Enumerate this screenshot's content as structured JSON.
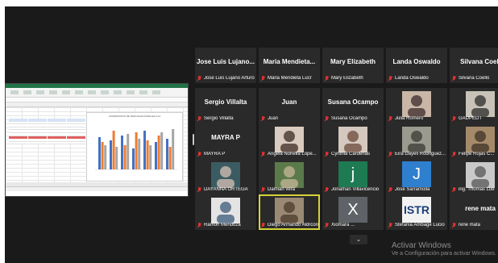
{
  "participants": [
    {
      "big": "Jose Luis Lujano...",
      "cap": "Jose Luis Lujano Arturo",
      "kind": "name"
    },
    {
      "big": "Maria Mendieta...",
      "cap": "Maria Mendieta Lucr",
      "kind": "name"
    },
    {
      "big": "Mary Elizabeth",
      "cap": "Mary Elizabeth",
      "kind": "name"
    },
    {
      "big": "Landa Oswaldo",
      "cap": "Landa Oswaldo",
      "kind": "name"
    },
    {
      "big": "Silvana Coell",
      "cap": "Silvana Coello",
      "kind": "name"
    },
    {
      "big": "Sergio Villalta",
      "cap": "Sergio Villalta",
      "kind": "name"
    },
    {
      "big": "Juan",
      "cap": "Juan",
      "kind": "name"
    },
    {
      "big": "Susana Ocampo",
      "cap": "Susana Ocampo",
      "kind": "name"
    },
    {
      "big": "",
      "cap": "Julia Romero",
      "kind": "photo",
      "bg": "#c9b6a6",
      "fg": "#3a2a2a"
    },
    {
      "big": "",
      "cap": "GADPEDT",
      "kind": "photo",
      "bg": "#c8c2b8",
      "fg": "#2b2b2b"
    },
    {
      "big": "MAYRA P",
      "cap": "MAYRA P",
      "kind": "name"
    },
    {
      "big": "",
      "cap": "Angela Nohelia Lópe...",
      "kind": "photo",
      "bg": "#d9cbbf",
      "fg": "#3b2b24"
    },
    {
      "big": "",
      "cap": "Cynthia Cardenas",
      "kind": "photo",
      "bg": "#d4c8bf",
      "fg": "#6b4a3a"
    },
    {
      "big": "",
      "cap": "Eira Dayeli Rodriguez...",
      "kind": "photo",
      "bg": "#9a9a8f",
      "fg": "#3a3a34"
    },
    {
      "big": "",
      "cap": "Felipe Rojas C...",
      "kind": "photo",
      "bg": "#a58a6a",
      "fg": "#3d3228"
    },
    {
      "big": "",
      "cap": "DAYANNA ORTEGA",
      "kind": "photo",
      "bg": "#3b5b62",
      "fg": "#d8c2b5"
    },
    {
      "big": "",
      "cap": "Damian vera",
      "kind": "photo",
      "bg": "#5b7a4a",
      "fg": "#c7b79a"
    },
    {
      "big": "",
      "cap": "Jonathan Villavicencio",
      "kind": "letter",
      "letter": "j",
      "bg": "#1e7a52"
    },
    {
      "big": "",
      "cap": "Jose Sarramolla",
      "kind": "letter",
      "letter": "J",
      "bg": "#2f7fcf"
    },
    {
      "big": "",
      "cap": "ing. Thomas Lue",
      "kind": "photo",
      "bg": "#c9c9c9",
      "fg": "#555555"
    },
    {
      "big": "",
      "cap": "Ramon Mendoza",
      "kind": "photo",
      "bg": "#e4e4e4",
      "fg": "#3a5a7a"
    },
    {
      "big": "",
      "cap": "Diego Armando Aldrcón",
      "kind": "photo",
      "bg": "#9a8a74",
      "fg": "#4a3a2a",
      "active": true
    },
    {
      "big": "",
      "cap": "Xiomara ...",
      "kind": "letter",
      "letter": "X",
      "bg": "#5f6368"
    },
    {
      "big": "",
      "cap": "Stefania Ambage Lucio",
      "kind": "logo",
      "logo": "ISTR",
      "bg": "#f2f2f2"
    },
    {
      "big": "rene mata",
      "cap": "rene mata",
      "kind": "name"
    }
  ],
  "chart_title": "COMPARATIVA DE PARCIALES PARALELO A1",
  "watermark": {
    "title": "Activar Windows",
    "subtitle": "Ve a Configuración para activar Windows."
  },
  "controls": {
    "chevron": "⌄"
  },
  "colors": {
    "mic": "#e03030",
    "active_border": "#d6d23a",
    "tile_bg": "#2a2a2a"
  }
}
